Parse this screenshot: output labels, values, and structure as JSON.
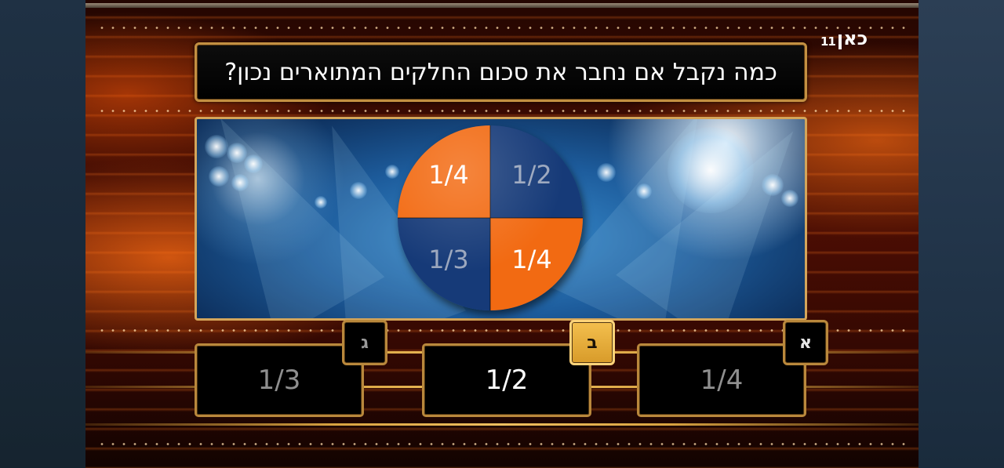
{
  "broadcaster": {
    "logo_word": "כאן",
    "logo_number": "11"
  },
  "question": {
    "text": "כמה נקבל אם נחבר את סכום החלקים המתוארים נכון?"
  },
  "pie": {
    "slices": [
      {
        "label": "1/4",
        "color": "#f26a12"
      },
      {
        "label": "1/2",
        "color": "#163a78"
      },
      {
        "label": "1/3",
        "color": "#163a78"
      },
      {
        "label": "1/4",
        "color": "#f26a12"
      }
    ]
  },
  "answers": [
    {
      "letter": "ג",
      "value": "1/3",
      "selected": false
    },
    {
      "letter": "ב",
      "value": "1/2",
      "selected": true
    },
    {
      "letter": "א",
      "value": "1/4",
      "selected": false
    }
  ],
  "colors": {
    "frame_gold": "#c39042",
    "selected_badge": "#f3bf4e",
    "pie_orange": "#f26a12",
    "pie_blue": "#163a78"
  }
}
